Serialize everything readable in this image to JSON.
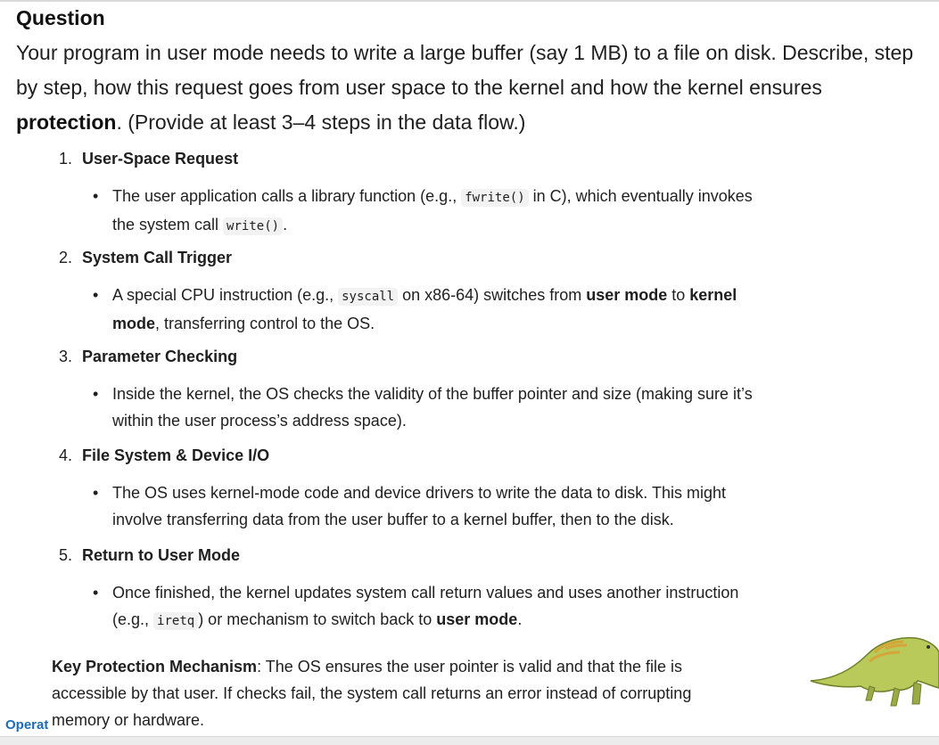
{
  "heading": "Question",
  "question": {
    "text_before": "Your program in user mode needs to write a large buffer (say 1 MB) to a file on disk. Describe, step by step, how this request goes from user space to the kernel and how the kernel ensures ",
    "bold": "protection",
    "text_after": ". (Provide at least 3–4 steps in the data flow.)"
  },
  "steps": [
    {
      "num": "1.",
      "title": "User-Space Request",
      "b_pre": "The user application calls a library function (e.g., ",
      "b_code1": "fwrite()",
      "b_mid": " in C), which eventually invokes the system call ",
      "b_code2": "write()",
      "b_post": "."
    },
    {
      "num": "2.",
      "title": "System Call Trigger",
      "b_pre": "A special CPU instruction (e.g., ",
      "b_code": "syscall",
      "b_mid": " on x86-64) switches from ",
      "b_bold1": "user mode",
      "b_mid2": " to ",
      "b_bold2": "kernel mode",
      "b_post": ", transferring control to the OS."
    },
    {
      "num": "3.",
      "title": "Parameter Checking",
      "b_text": "Inside the kernel, the OS checks the validity of the buffer pointer and size (making sure it’s within the user process’s address space)."
    },
    {
      "num": "4.",
      "title": "File System & Device I/O",
      "b_text": "The OS uses kernel-mode code and device drivers to write the data to disk. This might involve transferring data from the user buffer to a kernel buffer, then to the disk."
    },
    {
      "num": "5.",
      "title": "Return to User Mode",
      "b_pre": "Once finished, the kernel updates system call return values and uses another instruction (e.g., ",
      "b_code": "iretq",
      "b_mid": ") or mechanism to switch back to ",
      "b_bold": "user mode",
      "b_post": "."
    }
  ],
  "key_protection": {
    "label": "Key Protection Mechanism",
    "text": ": The OS ensures the user pointer is valid and that the file is accessible by that user. If checks fail, the system call returns an error instead of corrupting memory or hardware."
  },
  "footer_label": "Operating System Concepts",
  "bullet_char": "•",
  "colors": {
    "text": "#1f1f1f",
    "code_bg": "#f2f2f2",
    "footer_blue": "#1c6bb8"
  },
  "icons": {
    "dinosaur": "dinosaur-illustration"
  }
}
